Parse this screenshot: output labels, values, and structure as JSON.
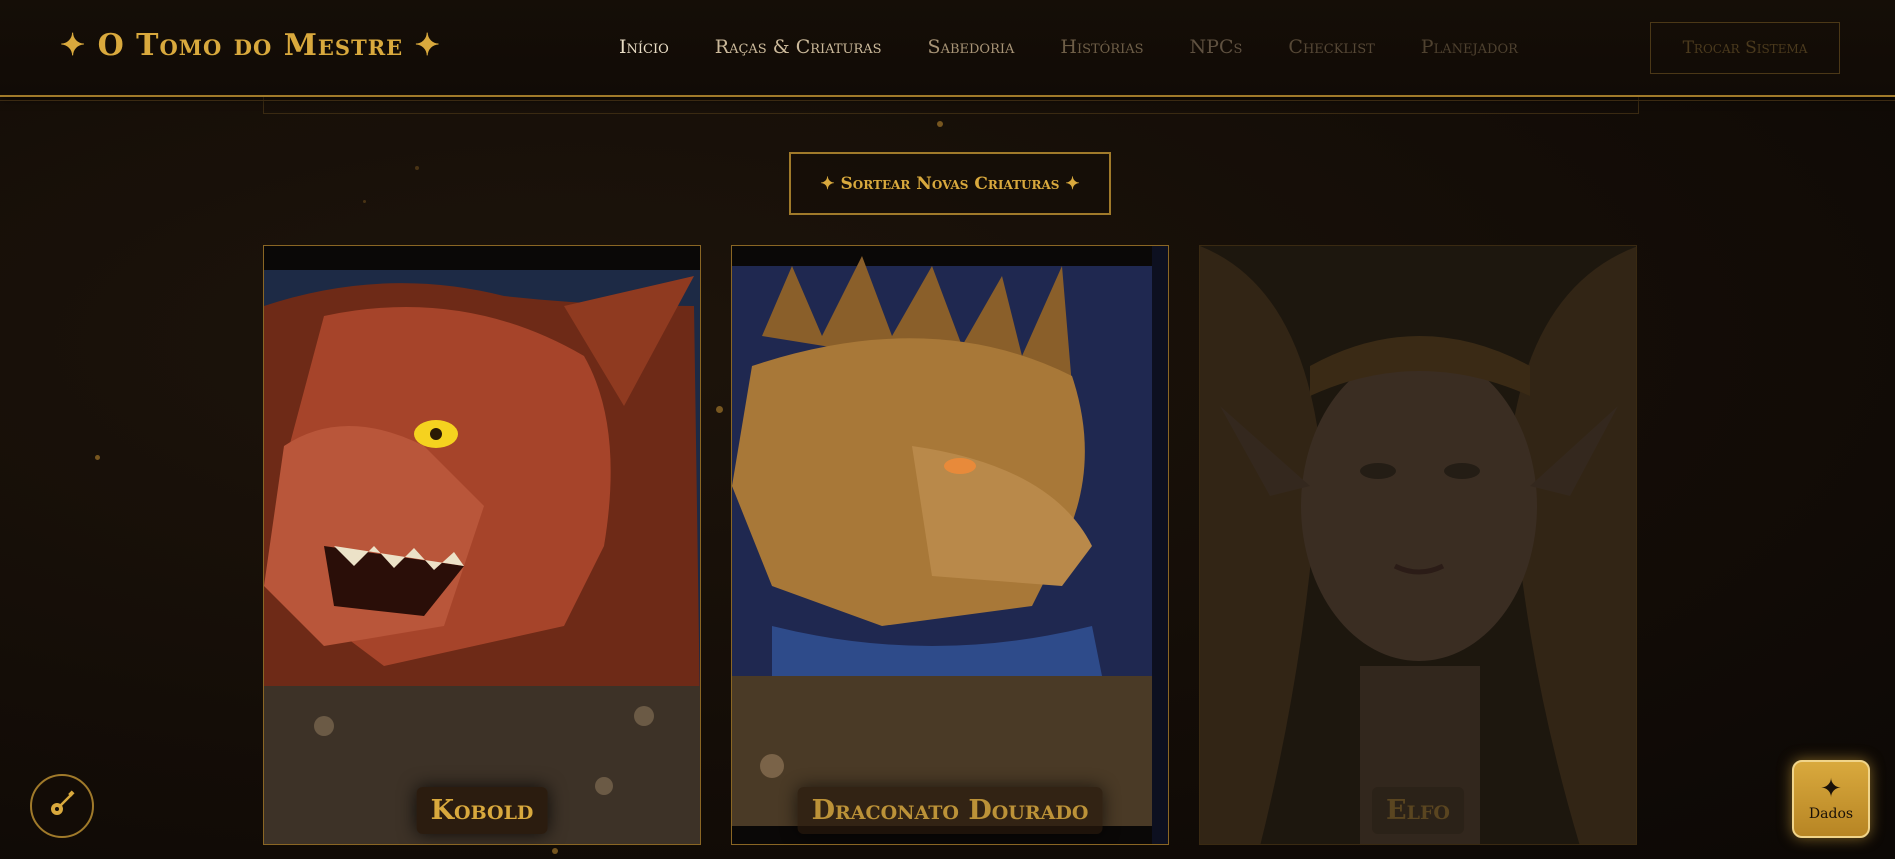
{
  "header": {
    "logo": "✦ O Tomo do Mestre ✦",
    "nav": [
      {
        "label": "Início"
      },
      {
        "label": "Raças & Criaturas"
      },
      {
        "label": "Sabedoria"
      },
      {
        "label": "Histórias"
      },
      {
        "label": "NPCs"
      },
      {
        "label": "Checklist"
      },
      {
        "label": "Planejador"
      }
    ],
    "switch_label": "Trocar Sistema"
  },
  "main": {
    "shuffle_label": "✦ Sortear Novas Criaturas ✦",
    "cards": [
      {
        "name": "Kobold"
      },
      {
        "name": "Draconato Dourado"
      },
      {
        "name": "Elfo"
      }
    ]
  },
  "floating": {
    "dice_label": "Dados",
    "dice_icon": "✦",
    "music_icon": "guitar-icon"
  },
  "colors": {
    "accent": "#d9a93d",
    "background": "#140d07",
    "border": "#a07a2a"
  }
}
